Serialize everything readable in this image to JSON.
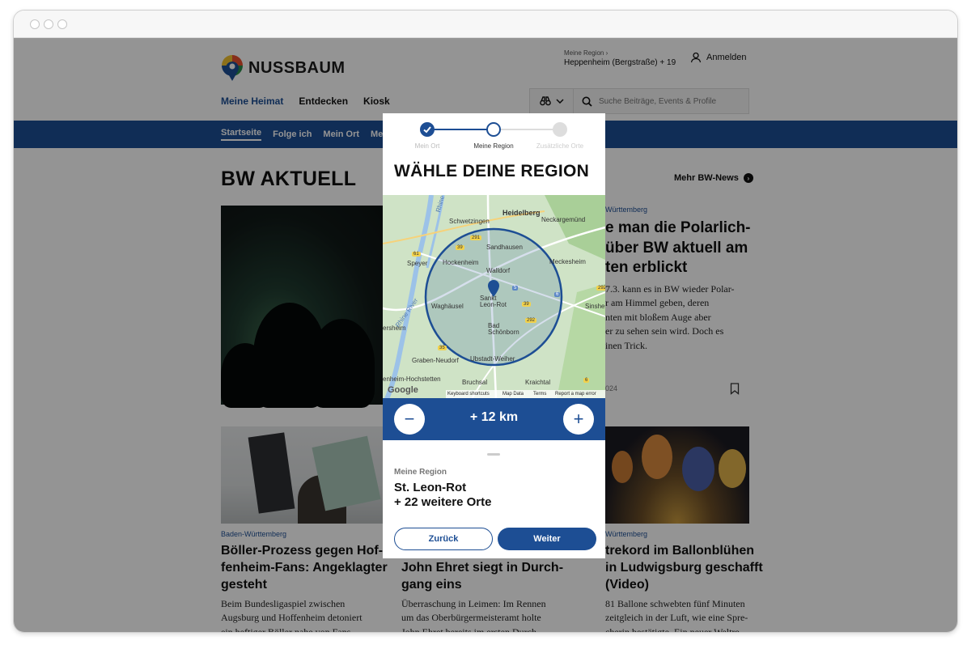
{
  "site": {
    "logo_text": "NUSSBAUM",
    "region_small": "Meine Region ›",
    "region_value": "Heppenheim (Bergstraße) + 19",
    "login_label": "Anmelden",
    "nav": [
      "Meine Heimat",
      "Entdecken",
      "Kiosk"
    ],
    "search_placeholder": "Suche Beiträge, Events & Profile",
    "subnav": [
      "Startseite",
      "Folge ich",
      "Mein Ort",
      "Mei"
    ],
    "section_title": "BW AKTUELL",
    "more_link": "Mehr BW-News",
    "accent": "#1d4e94"
  },
  "articles": {
    "top": {
      "category": "Württemberg",
      "headline_lines": [
        "e man die Polarlich-",
        "über BW aktuell am",
        "ten erblickt"
      ],
      "body_lines": [
        "7.3. kann es in BW wieder Polar-",
        "r am Himmel geben, deren",
        "nten mit bloßem Auge aber",
        "er zu sehen sein wird. Doch es",
        "inen Trick."
      ],
      "meta": "024"
    },
    "cards": [
      {
        "category": "Baden-Württemberg",
        "headline_lines": [
          "Böller-Prozess gegen Hof-",
          "fenheim-Fans: Angeklagter",
          "gesteht"
        ],
        "body_lines": [
          "Beim Bundesligaspiel zwischen",
          "Augsburg und Hoffenheim detoniert",
          "ein heftiger Böller nahe von Fans"
        ]
      },
      {
        "category": "",
        "headline_lines": [
          "John Ehret siegt in Durch-",
          "gang eins"
        ],
        "body_lines": [
          "Überraschung in Leimen: Im Rennen",
          "um das Oberbürgermeisteramt holte",
          "John Ehret bereits im ersten Durch-"
        ]
      },
      {
        "category": "Württemberg",
        "headline_lines": [
          "trekord im Ballonblühen",
          "in Ludwigsburg geschafft",
          "(Video)"
        ],
        "body_lines": [
          "81 Ballone schwebten fünf Minuten",
          "zeitgleich in der Luft, wie eine Spre-",
          "cherin bestätigte. Ein neuer Weltre-"
        ]
      }
    ]
  },
  "modal": {
    "steps": [
      "Mein Ort",
      "Meine Region",
      "Zusätzliche Orte"
    ],
    "title": "WÄHLE DEINE REGION",
    "radius": "+ 12 km",
    "minus": "−",
    "plus": "+",
    "sheet_label": "Meine Region",
    "sheet_place": "St. Leon-Rot",
    "sheet_more": "+ 22 weitere Orte",
    "back_label": "Zurück",
    "next_label": "Weiter",
    "map": {
      "places": [
        "Heidelberg",
        "Schwetzingen",
        "Neckargemünd",
        "Sandhausen",
        "Speyer",
        "Hockenheim",
        "Walldorf",
        "Meckesheim",
        "Sankt Leon-Rot",
        "Waghäusel",
        "Sinshei",
        "Bad Schönborn",
        "ersheim",
        "Graben-Neudorf",
        "Ubstadt-Weiher",
        "enheim-Hochstetten",
        "Bruchsal",
        "Kraichtal",
        "Rhine",
        "Rhine River"
      ],
      "road_shields": [
        "61",
        "291",
        "39",
        "5",
        "6",
        "39",
        "292",
        "35",
        "292",
        "6"
      ],
      "footer": [
        "Keyboard shortcuts",
        "Map Data",
        "Terms",
        "Report a map error"
      ],
      "google": "Google"
    }
  }
}
